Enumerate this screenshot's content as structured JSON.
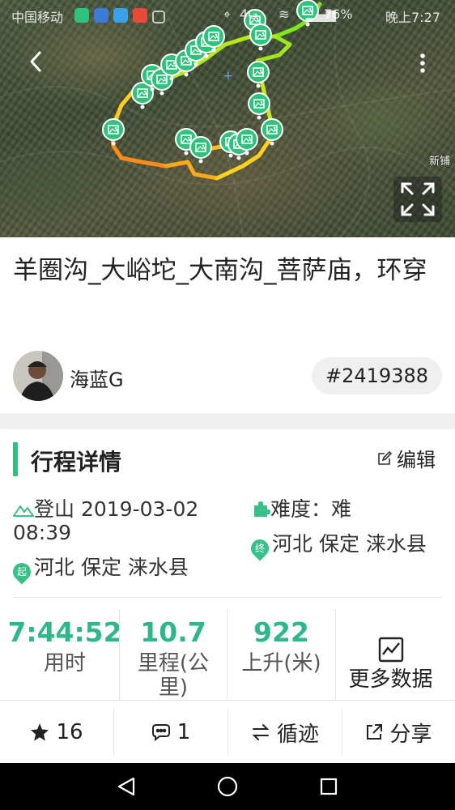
{
  "status_bar": {
    "carrier": "中国移动",
    "network": "4G",
    "battery": "76%",
    "time": "晚上7:27"
  },
  "map": {
    "place_label": "新铺",
    "route_colors": [
      "#ff8c1a",
      "#ffcc1a",
      "#c8e81a",
      "#7ee81a"
    ],
    "marker_color": "#2ec27e",
    "icons": {
      "back": "chevron-left-icon",
      "more": "more-vertical-icon",
      "fullscreen": "expand-icon"
    }
  },
  "trip": {
    "title": "羊圈沟_大峪坨_大南沟_菩萨庙，环穿",
    "author": "海蓝G",
    "id": "#2419388"
  },
  "details": {
    "section_title": "行程详情",
    "edit_label": "编辑",
    "type_label": "登山",
    "start_datetime": "2019-03-02 08:39",
    "difficulty_label": "难度：",
    "difficulty_value": "难",
    "start_marker": "起",
    "start_location": "河北 保定 涞水县",
    "end_marker": "终",
    "end_location": "河北 保定 涞水县"
  },
  "stats": {
    "duration_value": "7:44:52",
    "duration_label": "用时",
    "distance_value": "10.7",
    "distance_label": "里程(公里)",
    "ascent_value": "922",
    "ascent_label": "上升(米)",
    "more_label": "更多数据"
  },
  "actions": {
    "favorites": "16",
    "comments": "1",
    "follow_label": "循迹",
    "share_label": "分享"
  },
  "accent_color": "#2ec27e"
}
